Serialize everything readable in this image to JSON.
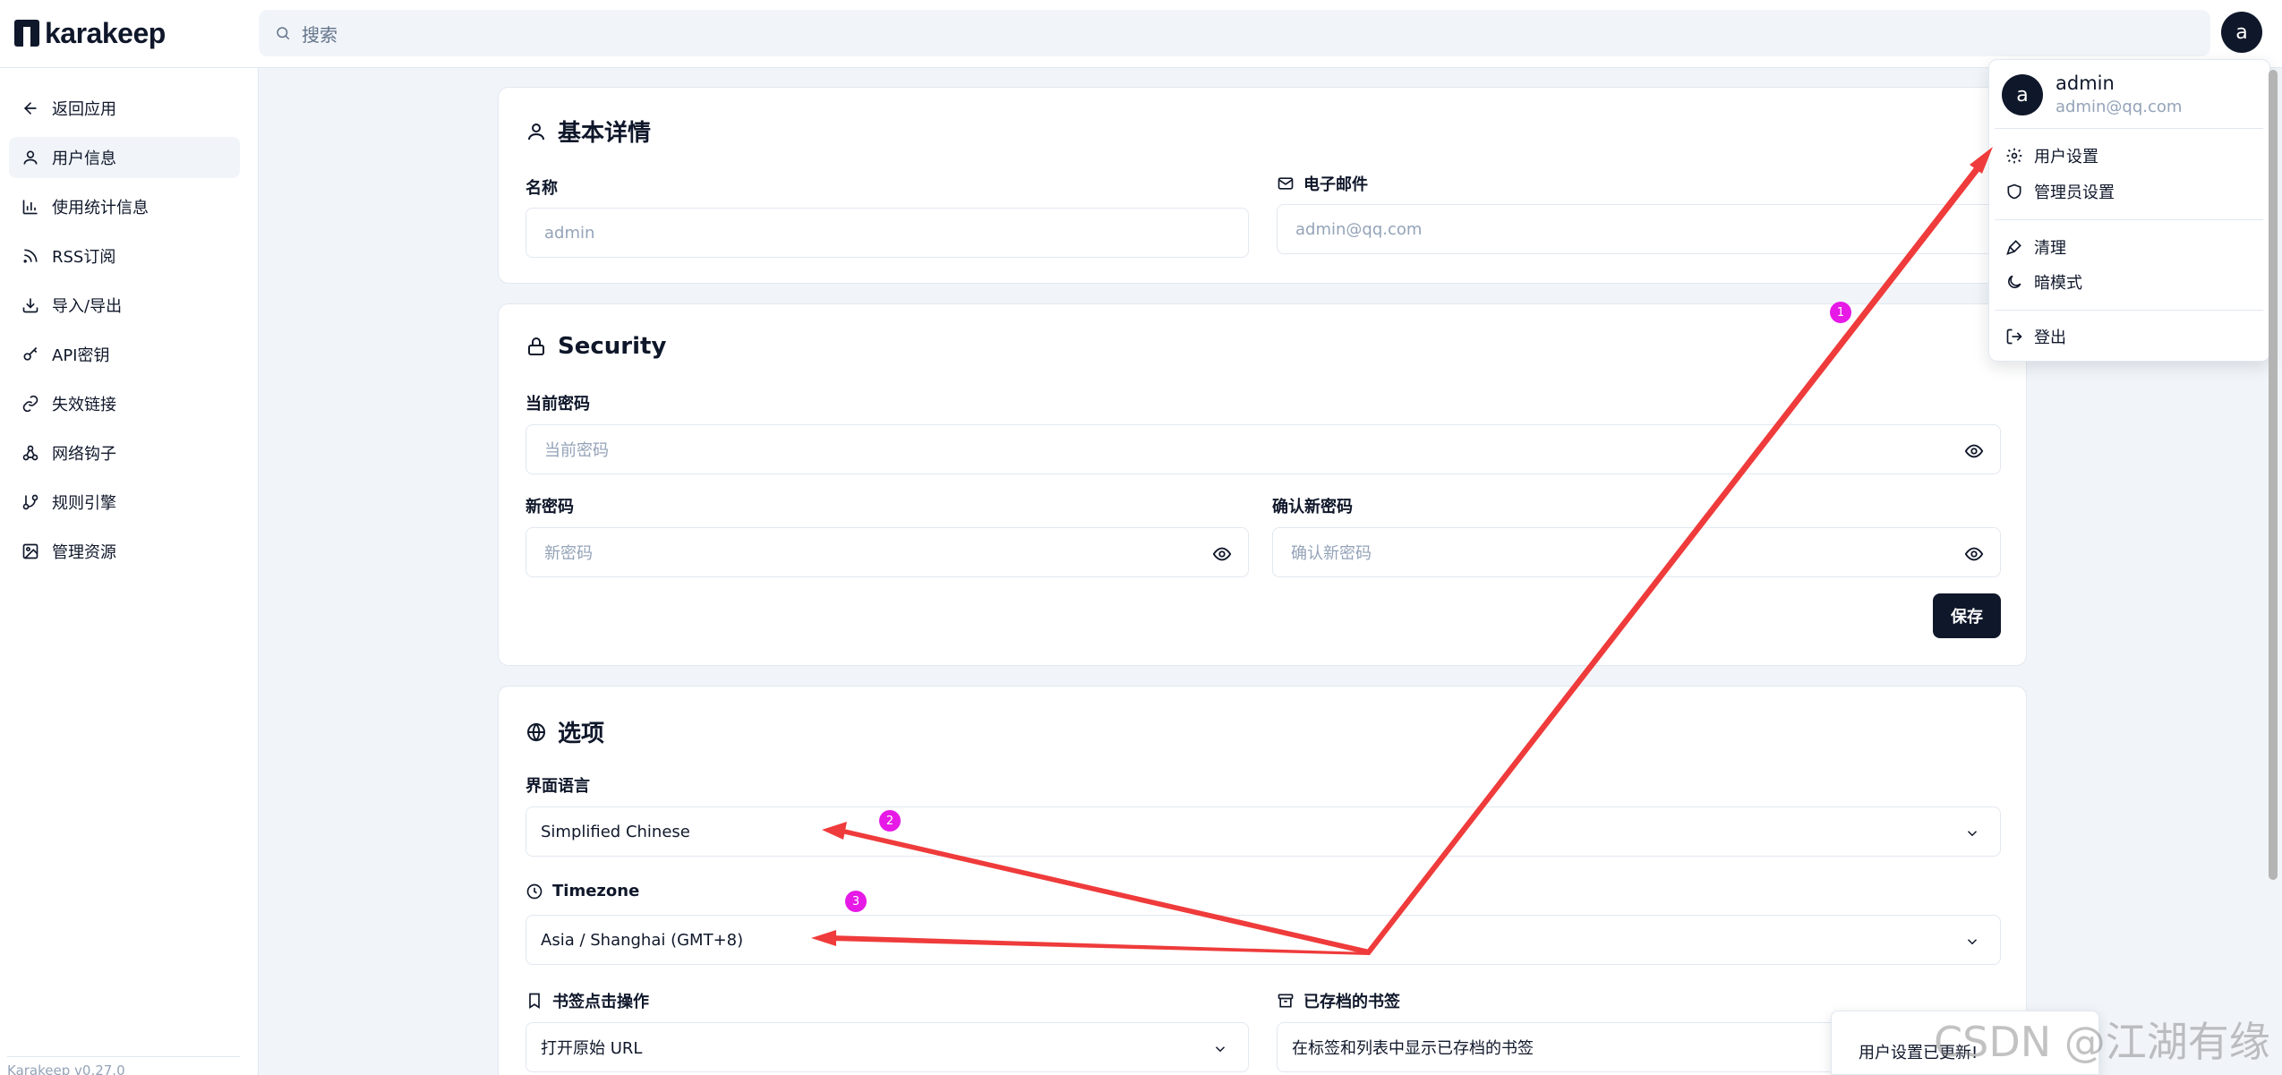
{
  "app": {
    "name": "karakeep",
    "version": "Karakeep v0.27.0"
  },
  "search": {
    "placeholder": "搜索"
  },
  "user": {
    "initial": "a",
    "name": "admin",
    "email": "admin@qq.com"
  },
  "sidebar": {
    "items": [
      {
        "label": "返回应用",
        "icon": "arrow-left-icon"
      },
      {
        "label": "用户信息",
        "icon": "user-icon",
        "active": true
      },
      {
        "label": "使用统计信息",
        "icon": "bar-chart-icon"
      },
      {
        "label": "RSS订阅",
        "icon": "rss-icon"
      },
      {
        "label": "导入/导出",
        "icon": "download-icon"
      },
      {
        "label": "API密钥",
        "icon": "key-icon"
      },
      {
        "label": "失效链接",
        "icon": "link-icon"
      },
      {
        "label": "网络钩子",
        "icon": "webhook-icon"
      },
      {
        "label": "规则引擎",
        "icon": "git-branch-icon"
      },
      {
        "label": "管理资源",
        "icon": "image-icon"
      }
    ]
  },
  "basic": {
    "title": "基本详情",
    "name_label": "名称",
    "name_value": "admin",
    "email_label": "电子邮件",
    "email_value": "admin@qq.com"
  },
  "security": {
    "title": "Security",
    "current_label": "当前密码",
    "current_placeholder": "当前密码",
    "new_label": "新密码",
    "new_placeholder": "新密码",
    "confirm_label": "确认新密码",
    "confirm_placeholder": "确认新密码",
    "save_label": "保存"
  },
  "options": {
    "title": "选项",
    "language_label": "界面语言",
    "language_value": "Simplified Chinese",
    "timezone_label": "Timezone",
    "timezone_value": "Asia / Shanghai (GMT+8)",
    "click_label": "书签点击操作",
    "click_value": "打开原始 URL",
    "archived_label": "已存档的书签",
    "archived_value": "在标签和列表中显示已存档的书签"
  },
  "menu": {
    "items": [
      {
        "label": "用户设置",
        "icon": "settings-icon"
      },
      {
        "label": "管理员设置",
        "icon": "shield-icon"
      },
      {
        "label": "清理",
        "icon": "brush-icon"
      },
      {
        "label": "暗模式",
        "icon": "moon-icon"
      },
      {
        "label": "登出",
        "icon": "logout-icon"
      }
    ]
  },
  "toast": {
    "text": "用户设置已更新!"
  },
  "annotations": {
    "badges": [
      "1",
      "2",
      "3"
    ],
    "arrow_color": "#ef3b3b",
    "badge_color": "#e619e6"
  },
  "watermark": {
    "text": "CSDN @江湖有缘"
  }
}
